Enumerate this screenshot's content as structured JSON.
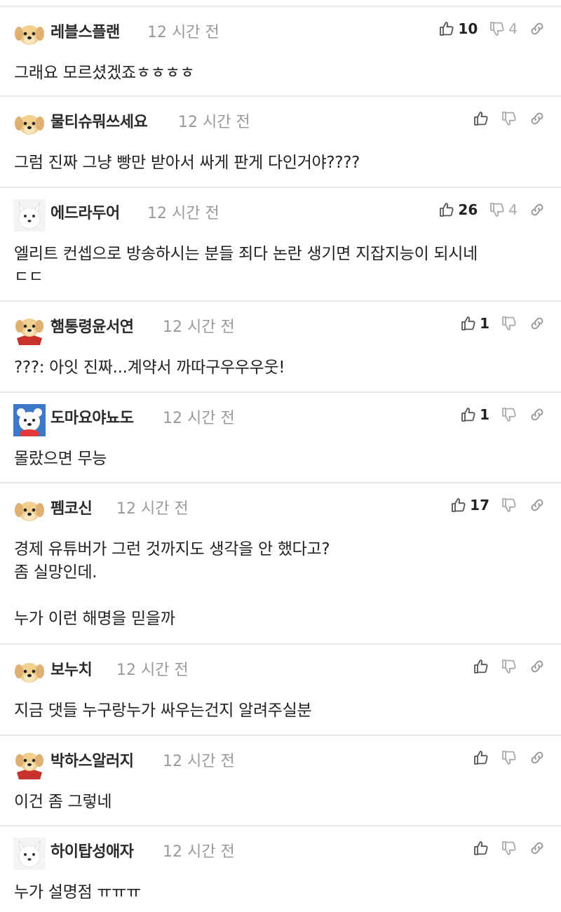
{
  "comments": [
    {
      "nickname": "레블스플랜",
      "time": "12 시간 전",
      "text": "그래요 모르셨겠죠ㅎㅎㅎㅎ",
      "likes": "10",
      "dislikes": "4",
      "avatar": "puppy-tan"
    },
    {
      "nickname": "물티슈뭐쓰세요",
      "time": "12 시간 전",
      "text": "그럼 진짜 그냥 빵만 받아서 싸게 판게 다인거야????",
      "likes": "",
      "dislikes": "",
      "avatar": "puppy-tan"
    },
    {
      "nickname": "에드라두어",
      "time": "12 시간 전",
      "text": "엘리트 컨셉으로 방송하시는 분들 죄다 논란 생기면 지잡지능이 되시네\nㄷㄷ",
      "likes": "26",
      "dislikes": "4",
      "avatar": "dog-white"
    },
    {
      "nickname": "햄통령윤서연",
      "time": "12 시간 전",
      "text": "???: 아잇 진짜...계약서 까따구우우우웃!",
      "likes": "1",
      "dislikes": "",
      "avatar": "puppy-cape"
    },
    {
      "nickname": "도마요야뇨도",
      "time": "12 시간 전",
      "text": "몰랐으면 무능",
      "likes": "1",
      "dislikes": "",
      "avatar": "bear-blue"
    },
    {
      "nickname": "펨코신",
      "time": "12 시간 전",
      "text": "경제 유튜버가 그런 것까지도 생각을 안 했다고?\n좀 실망인데.\n\n누가 이런 해명을 믿을까",
      "likes": "17",
      "dislikes": "",
      "avatar": "puppy-tan"
    },
    {
      "nickname": "보누치",
      "time": "12 시간 전",
      "text": "지금 댓들 누구랑누가 싸우는건지 알려주실분",
      "likes": "",
      "dislikes": "",
      "avatar": "puppy-tan"
    },
    {
      "nickname": "박하스알러지",
      "time": "12 시간 전",
      "text": "이건 좀 그렇네",
      "likes": "",
      "dislikes": "",
      "avatar": "puppy-cape"
    },
    {
      "nickname": "하이탑성애자",
      "time": "12 시간 전",
      "text": "누가 설명점 ㅠㅠㅠ",
      "likes": "",
      "dislikes": "",
      "avatar": "dog-white"
    }
  ],
  "colors": {
    "divider": "#e9e9e9",
    "nickname": "#2a2a2a",
    "time": "#999999",
    "text": "#222222",
    "icon": "#555555",
    "count_muted": "#aaaaaa"
  },
  "icons": {
    "like": "thumbs-up-icon",
    "dislike": "thumbs-down-icon",
    "link": "link-icon"
  }
}
